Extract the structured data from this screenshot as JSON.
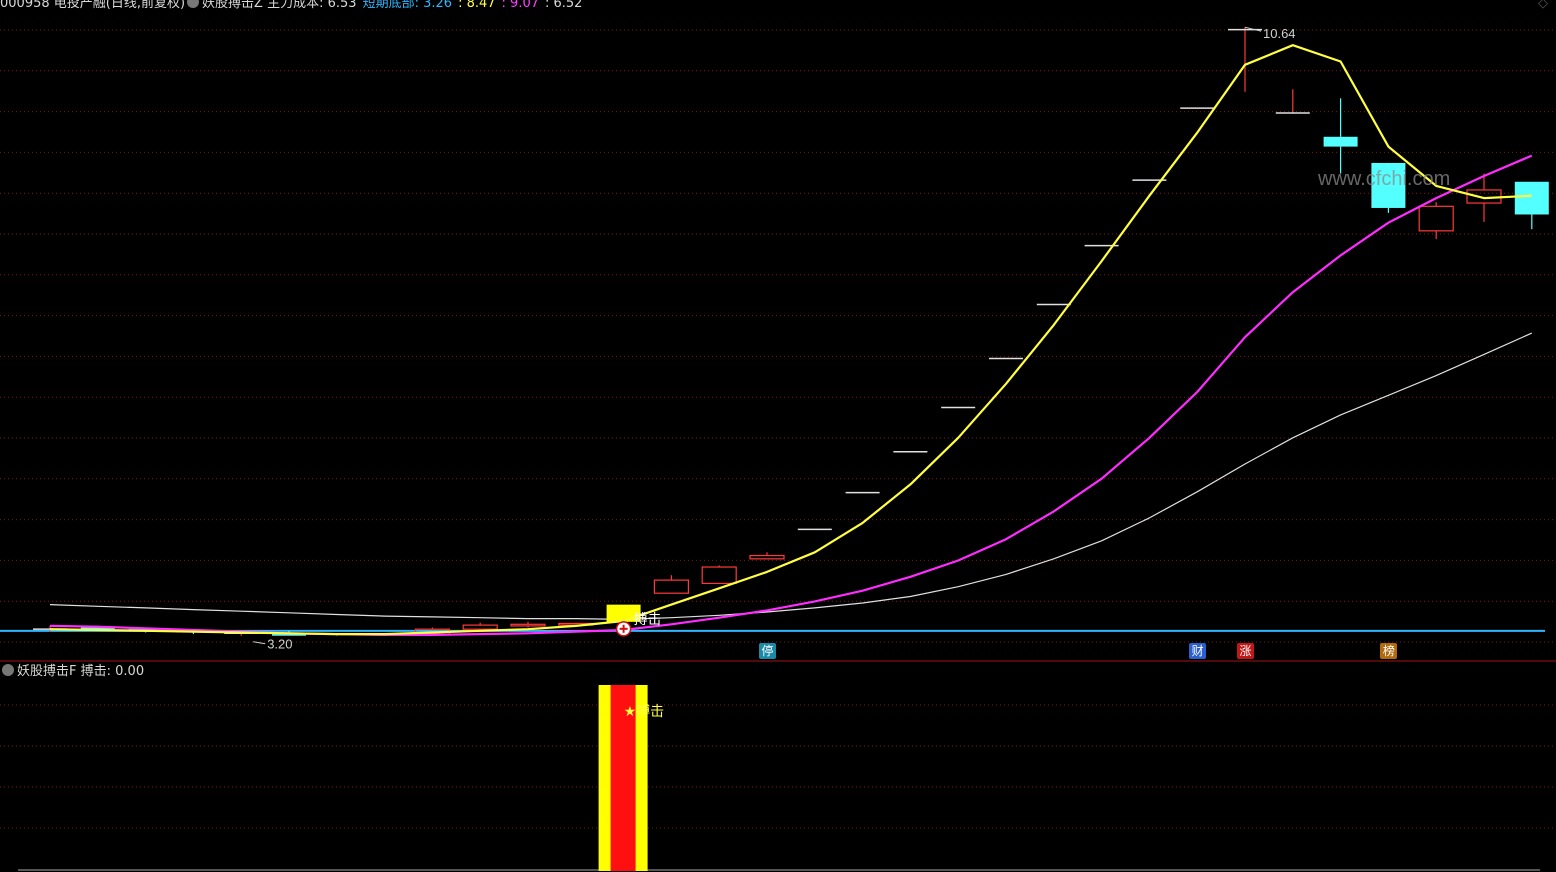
{
  "header": {
    "symbol": "000958 电投产融(日线,前复权)",
    "indicator_name": "妖股搏击Z",
    "main_cost_label": "主力成本",
    "main_cost_value": ": 6.53",
    "short_bottom_label": "短期底部",
    "v1": ": 3.26",
    "v2": ": 8.47",
    "v3": ": 9.07",
    "v4": ": 6.52",
    "corner_icon": "◇"
  },
  "watermark": "www.cfchi.com",
  "sub_header": {
    "indicator_name": "妖股搏击F",
    "label": "搏击",
    "value": ": 0.00"
  },
  "chart_data": {
    "type": "candlestick",
    "price_range": [
      3.05,
      10.85
    ],
    "colors": {
      "up": "#ff3a3a",
      "down": "#54ffff",
      "ma_yellow": "#ffff40",
      "ma_magenta": "#ff2cff",
      "ma_white": "#e0e0e0",
      "support": "#2fb6ff",
      "grid": "#7a1a1a"
    },
    "annotations": {
      "high_label": "10.64",
      "low_label": "3.20",
      "signal_text": "搏击",
      "bottom_signal_text": "★搏击"
    },
    "tags": [
      {
        "text": "停",
        "bg": "#1a8aa8",
        "color": "#ffffff",
        "index": 15
      },
      {
        "text": "财",
        "bg": "#2a5fd0",
        "color": "#ffffff",
        "index": 24
      },
      {
        "text": "涨",
        "bg": "#c01818",
        "color": "#ffffff",
        "index": 25
      },
      {
        "text": "榜",
        "bg": "#b06a10",
        "color": "#ffffff",
        "index": 28
      }
    ],
    "support_level": 3.26,
    "candles": [
      {
        "o": 3.28,
        "h": 3.32,
        "l": 3.25,
        "c": 3.28
      },
      {
        "o": 3.3,
        "h": 3.32,
        "l": 3.26,
        "c": 3.28
      },
      {
        "o": 3.28,
        "h": 3.3,
        "l": 3.24,
        "c": 3.26
      },
      {
        "o": 3.26,
        "h": 3.28,
        "l": 3.22,
        "c": 3.24
      },
      {
        "o": 3.22,
        "h": 3.25,
        "l": 3.2,
        "c": 3.23
      },
      {
        "o": 3.22,
        "h": 3.26,
        "l": 3.2,
        "c": 3.2
      },
      {
        "o": 3.21,
        "h": 3.23,
        "l": 3.2,
        "c": 3.22
      },
      {
        "o": 3.21,
        "h": 3.23,
        "l": 3.2,
        "c": 3.22
      },
      {
        "o": 3.22,
        "h": 3.3,
        "l": 3.21,
        "c": 3.28
      },
      {
        "o": 3.28,
        "h": 3.36,
        "l": 3.27,
        "c": 3.33
      },
      {
        "o": 3.32,
        "h": 3.37,
        "l": 3.3,
        "c": 3.34
      },
      {
        "o": 3.33,
        "h": 3.36,
        "l": 3.31,
        "c": 3.35
      },
      {
        "o": 3.37,
        "h": 3.58,
        "l": 3.37,
        "c": 3.58
      },
      {
        "o": 3.72,
        "h": 3.94,
        "l": 3.72,
        "c": 3.88
      },
      {
        "o": 3.84,
        "h": 4.06,
        "l": 3.84,
        "c": 4.04
      },
      {
        "o": 4.14,
        "h": 4.22,
        "l": 4.14,
        "c": 4.18
      },
      {
        "o": 4.5,
        "h": 4.5,
        "l": 4.5,
        "c": 4.5
      },
      {
        "o": 4.95,
        "h": 4.95,
        "l": 4.95,
        "c": 4.95
      },
      {
        "o": 5.45,
        "h": 5.45,
        "l": 5.45,
        "c": 5.45
      },
      {
        "o": 5.99,
        "h": 5.99,
        "l": 5.99,
        "c": 5.99
      },
      {
        "o": 6.59,
        "h": 6.59,
        "l": 6.59,
        "c": 6.59
      },
      {
        "o": 7.25,
        "h": 7.25,
        "l": 7.25,
        "c": 7.25
      },
      {
        "o": 7.97,
        "h": 7.97,
        "l": 7.97,
        "c": 7.97
      },
      {
        "o": 8.77,
        "h": 8.77,
        "l": 8.77,
        "c": 8.77
      },
      {
        "o": 9.65,
        "h": 9.65,
        "l": 9.65,
        "c": 9.65
      },
      {
        "o": 10.61,
        "h": 10.64,
        "l": 9.85,
        "c": 10.61
      },
      {
        "o": 9.59,
        "h": 9.88,
        "l": 9.59,
        "c": 9.59
      },
      {
        "o": 9.3,
        "h": 9.77,
        "l": 8.85,
        "c": 9.18
      },
      {
        "o": 8.98,
        "h": 8.98,
        "l": 8.37,
        "c": 8.43
      },
      {
        "o": 8.15,
        "h": 8.5,
        "l": 8.05,
        "c": 8.45
      },
      {
        "o": 8.49,
        "h": 8.85,
        "l": 8.26,
        "c": 8.65
      },
      {
        "o": 8.75,
        "h": 8.75,
        "l": 8.17,
        "c": 8.35
      }
    ],
    "ma_yellow": [
      3.28,
      3.27,
      3.26,
      3.25,
      3.24,
      3.23,
      3.22,
      3.22,
      3.24,
      3.26,
      3.28,
      3.32,
      3.38,
      3.58,
      3.78,
      3.98,
      4.22,
      4.58,
      5.05,
      5.62,
      6.28,
      7.0,
      7.78,
      8.58,
      9.35,
      10.18,
      10.42,
      10.22,
      9.18,
      8.7,
      8.55,
      8.58
    ],
    "ma_magenta": [
      3.32,
      3.31,
      3.29,
      3.27,
      3.25,
      3.23,
      3.22,
      3.21,
      3.21,
      3.22,
      3.23,
      3.25,
      3.27,
      3.34,
      3.42,
      3.51,
      3.62,
      3.75,
      3.92,
      4.12,
      4.38,
      4.72,
      5.12,
      5.62,
      6.18,
      6.85,
      7.4,
      7.85,
      8.25,
      8.55,
      8.82,
      9.07
    ],
    "ma_white": [
      3.58,
      3.56,
      3.54,
      3.52,
      3.5,
      3.48,
      3.46,
      3.44,
      3.43,
      3.42,
      3.41,
      3.41,
      3.4,
      3.42,
      3.45,
      3.49,
      3.54,
      3.6,
      3.68,
      3.8,
      3.95,
      4.14,
      4.36,
      4.64,
      4.96,
      5.3,
      5.62,
      5.9,
      6.14,
      6.38,
      6.64,
      6.9
    ],
    "signal_index": 12,
    "sub_signal": {
      "index": 12,
      "value": 1
    }
  }
}
